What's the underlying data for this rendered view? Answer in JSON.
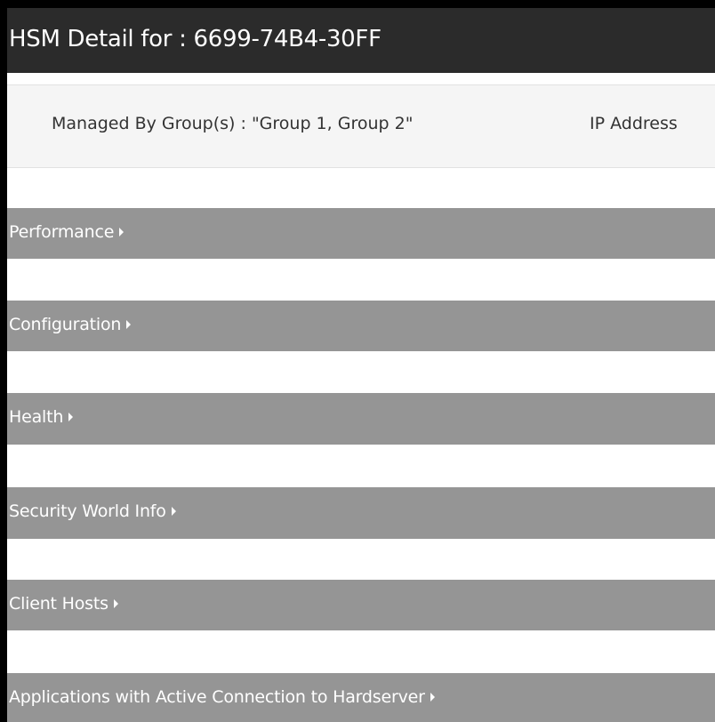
{
  "header": {
    "title": "HSM Detail for : 6699-74B4-30FF"
  },
  "info": {
    "managed_by": "Managed By Group(s) : \"Group 1, Group 2\"",
    "ip_address": "IP Address"
  },
  "sections": [
    {
      "label": "Performance",
      "icon": "caret-right-icon"
    },
    {
      "label": "Configuration",
      "icon": "caret-right-icon"
    },
    {
      "label": "Health",
      "icon": "caret-right-icon"
    },
    {
      "label": "Security World Info",
      "icon": "caret-right-icon"
    },
    {
      "label": "Client Hosts",
      "icon": "caret-right-icon"
    },
    {
      "label": "Applications with Active Connection to Hardserver",
      "icon": "caret-right-icon"
    }
  ],
  "colors": {
    "title_bar": "#2b2b2b",
    "section_bar": "#959595",
    "info_bar": "#f5f5f5",
    "border": "#000000"
  }
}
